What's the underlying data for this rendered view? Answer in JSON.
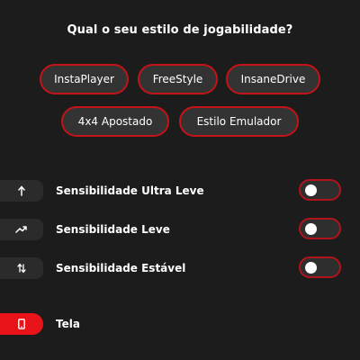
{
  "title": "Qual o seu estilo de jogabilidade?",
  "styles": [
    {
      "label": "InstaPlayer"
    },
    {
      "label": "FreeStyle"
    },
    {
      "label": "InsaneDrive"
    },
    {
      "label": "4x4 Apostado"
    },
    {
      "label": "Estilo Emulador"
    }
  ],
  "sensitivity": [
    {
      "label": "Sensibilidade Ultra Leve",
      "icon": "arrow-up-icon",
      "enabled": false
    },
    {
      "label": "Sensibilidade Leve",
      "icon": "trend-up-icon",
      "enabled": false
    },
    {
      "label": "Sensibilidade Estável",
      "icon": "swap-vertical-icon",
      "enabled": false
    }
  ],
  "screen": {
    "label": "Tela",
    "icon": "phone-icon"
  },
  "colors": {
    "accent": "#e8141a",
    "background": "#1c1c1c",
    "pill": "#333333"
  }
}
